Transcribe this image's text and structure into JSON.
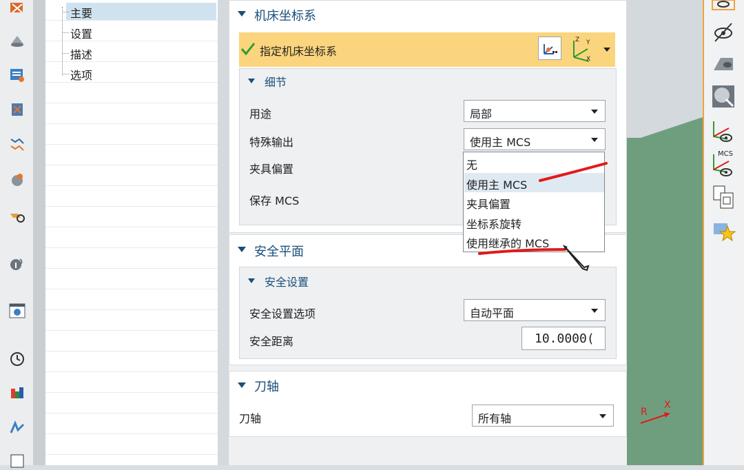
{
  "navigator": {
    "items": [
      {
        "label": "主要"
      },
      {
        "label": "设置"
      },
      {
        "label": "描述"
      },
      {
        "label": "选项"
      }
    ]
  },
  "mcs_section": {
    "title": "机床坐标系",
    "specify_label": "指定机床坐标系",
    "details": {
      "title": "细节",
      "purpose_label": "用途",
      "purpose_value": "局部",
      "special_output_label": "特殊输出",
      "special_output_value": "使用主 MCS",
      "fixture_offset_label": "夹具偏置",
      "save_mcs_label": "保存 MCS",
      "special_output_options": [
        "无",
        "使用主 MCS",
        "夹具偏置",
        "坐标系旋转",
        "使用继承的 MCS"
      ]
    }
  },
  "safety_section": {
    "title": "安全平面",
    "settings": {
      "title": "安全设置",
      "option_label": "安全设置选项",
      "option_value": "自动平面",
      "distance_label": "安全距离",
      "distance_value": "10.0000("
    }
  },
  "tool_axis_section": {
    "title": "刀轴",
    "axis_label": "刀轴",
    "axis_value": "所有轴"
  },
  "icons": {
    "right_toolbar_label": "MCS",
    "triad_axes": [
      "Z",
      "Y",
      "X"
    ],
    "gfx_axis": [
      "R",
      "X"
    ]
  },
  "colors": {
    "accent": "#f0a23a",
    "highlight": "#fbd57d",
    "title_blue": "#1a4f7a",
    "annotation_red": "#e11a1a",
    "graphics_green": "#6f9e7f"
  }
}
